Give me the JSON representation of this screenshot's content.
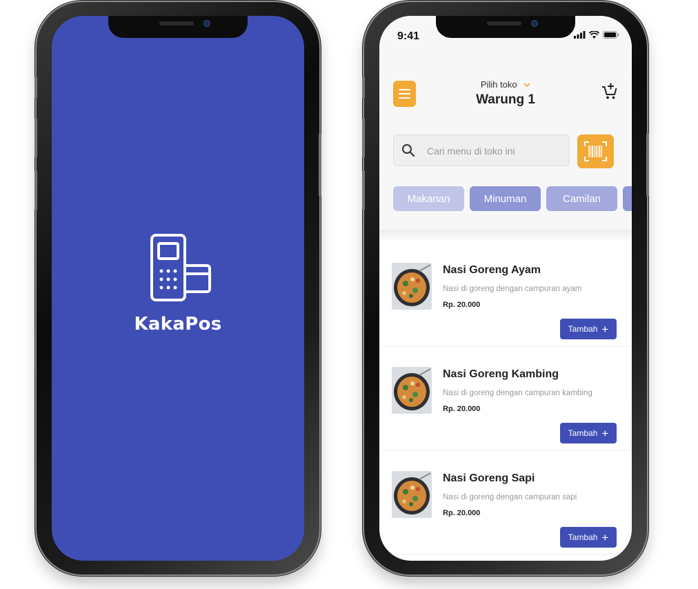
{
  "splash": {
    "brand": "KakaPos",
    "bg_color": "#3f4eb5",
    "logo_icon": "card-terminal-icon"
  },
  "app": {
    "status": {
      "time": "9:41"
    },
    "header": {
      "store_label": "Pilih toko",
      "store_name": "Warung 1",
      "menu_icon": "hamburger-icon",
      "cart_icon": "cart-add-icon"
    },
    "search": {
      "placeholder": "Cari menu di toko ini",
      "scan_icon": "barcode-scan-icon"
    },
    "categories": [
      {
        "label": "Makanan"
      },
      {
        "label": "Minuman"
      },
      {
        "label": "Camilan"
      },
      {
        "label": ""
      }
    ],
    "menu_items": [
      {
        "name": "Nasi Goreng Ayam",
        "description": "Nasi di goreng dengan campuran ayam",
        "price": "Rp. 20.000",
        "button_label": "Tambah"
      },
      {
        "name": "Nasi Goreng Kambing",
        "description": "Nasi di goreng dengan campuran kambing",
        "price": "Rp. 20.000",
        "button_label": "Tambah"
      },
      {
        "name": "Nasi Goreng Sapi",
        "description": "Nasi di goreng dengan campuran sapi",
        "price": "Rp. 20.000",
        "button_label": "Tambah"
      }
    ],
    "colors": {
      "accent": "#f3a935",
      "primary": "#3f4eb5"
    }
  }
}
